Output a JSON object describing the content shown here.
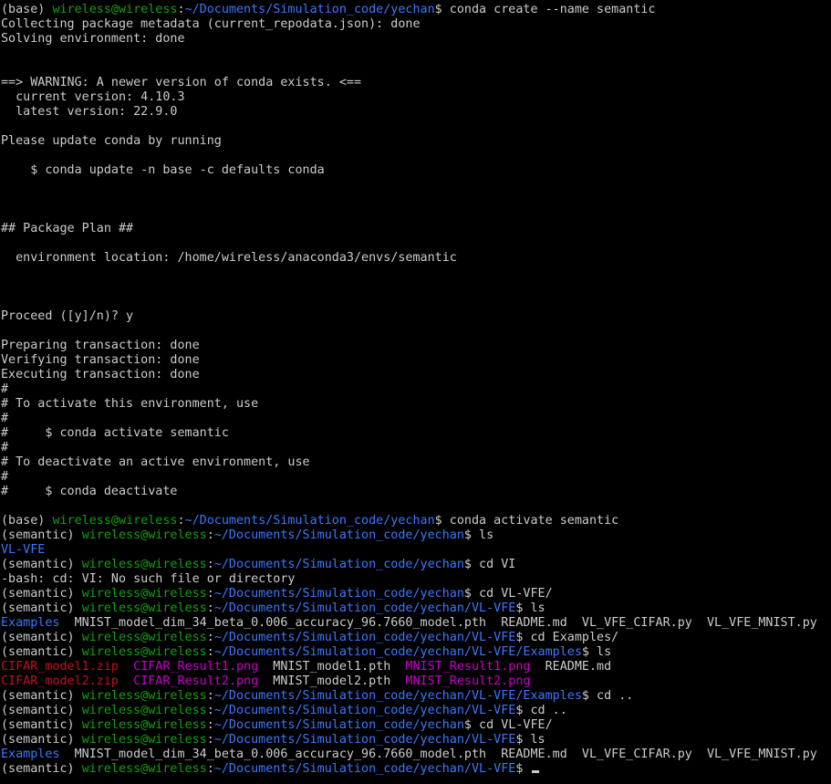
{
  "lines": [
    [
      [
        "p",
        "(base) "
      ],
      [
        "u",
        "wireless@wireless"
      ],
      [
        "p",
        ":"
      ],
      [
        "d",
        "~/Documents/Simulation_code/yechan"
      ],
      [
        "p",
        "$ conda create --name semantic"
      ]
    ],
    [
      [
        "p",
        "Collecting package metadata (current_repodata.json): done"
      ]
    ],
    [
      [
        "p",
        "Solving environment: done"
      ]
    ],
    [],
    [],
    [
      [
        "p",
        "==> WARNING: A newer version of conda exists. <=="
      ]
    ],
    [
      [
        "p",
        "  current version: 4.10.3"
      ]
    ],
    [
      [
        "p",
        "  latest version: 22.9.0"
      ]
    ],
    [],
    [
      [
        "p",
        "Please update conda by running"
      ]
    ],
    [],
    [
      [
        "p",
        "    $ conda update -n base -c defaults conda"
      ]
    ],
    [],
    [],
    [],
    [
      [
        "p",
        "## Package Plan ##"
      ]
    ],
    [],
    [
      [
        "p",
        "  environment location: /home/wireless/anaconda3/envs/semantic"
      ]
    ],
    [],
    [],
    [],
    [
      [
        "p",
        "Proceed ([y]/n)? y"
      ]
    ],
    [],
    [
      [
        "p",
        "Preparing transaction: done"
      ]
    ],
    [
      [
        "p",
        "Verifying transaction: done"
      ]
    ],
    [
      [
        "p",
        "Executing transaction: done"
      ]
    ],
    [
      [
        "p",
        "#"
      ]
    ],
    [
      [
        "p",
        "# To activate this environment, use"
      ]
    ],
    [
      [
        "p",
        "#"
      ]
    ],
    [
      [
        "p",
        "#     $ conda activate semantic"
      ]
    ],
    [
      [
        "p",
        "#"
      ]
    ],
    [
      [
        "p",
        "# To deactivate an active environment, use"
      ]
    ],
    [
      [
        "p",
        "#"
      ]
    ],
    [
      [
        "p",
        "#     $ conda deactivate"
      ]
    ],
    [],
    [
      [
        "p",
        "(base) "
      ],
      [
        "u",
        "wireless@wireless"
      ],
      [
        "p",
        ":"
      ],
      [
        "d",
        "~/Documents/Simulation_code/yechan"
      ],
      [
        "p",
        "$ conda activate semantic"
      ]
    ],
    [
      [
        "p",
        "(semantic) "
      ],
      [
        "u",
        "wireless@wireless"
      ],
      [
        "p",
        ":"
      ],
      [
        "d",
        "~/Documents/Simulation_code/yechan"
      ],
      [
        "p",
        "$ ls"
      ]
    ],
    [
      [
        "f",
        "VL-VFE"
      ]
    ],
    [
      [
        "p",
        "(semantic) "
      ],
      [
        "u",
        "wireless@wireless"
      ],
      [
        "p",
        ":"
      ],
      [
        "d",
        "~/Documents/Simulation_code/yechan"
      ],
      [
        "p",
        "$ cd VI"
      ]
    ],
    [
      [
        "p",
        "-bash: cd: VI: No such file or directory"
      ]
    ],
    [
      [
        "p",
        "(semantic) "
      ],
      [
        "u",
        "wireless@wireless"
      ],
      [
        "p",
        ":"
      ],
      [
        "d",
        "~/Documents/Simulation_code/yechan"
      ],
      [
        "p",
        "$ cd VL-VFE/"
      ]
    ],
    [
      [
        "p",
        "(semantic) "
      ],
      [
        "u",
        "wireless@wireless"
      ],
      [
        "p",
        ":"
      ],
      [
        "d",
        "~/Documents/Simulation_code/yechan/VL-VFE"
      ],
      [
        "p",
        "$ ls"
      ]
    ],
    [
      [
        "f",
        "Examples"
      ],
      [
        "p",
        "  MNIST_model_dim_34_beta_0.006_accuracy_96.7660_model.pth  README.md  VL_VFE_CIFAR.py  VL_VFE_MNIST.py"
      ]
    ],
    [
      [
        "p",
        "(semantic) "
      ],
      [
        "u",
        "wireless@wireless"
      ],
      [
        "p",
        ":"
      ],
      [
        "d",
        "~/Documents/Simulation_code/yechan/VL-VFE"
      ],
      [
        "p",
        "$ cd Examples/"
      ]
    ],
    [
      [
        "p",
        "(semantic) "
      ],
      [
        "u",
        "wireless@wireless"
      ],
      [
        "p",
        ":"
      ],
      [
        "d",
        "~/Documents/Simulation_code/yechan/VL-VFE/Examples"
      ],
      [
        "p",
        "$ ls"
      ]
    ],
    [
      [
        "z",
        "CIFAR_model1.zip"
      ],
      [
        "p",
        "  "
      ],
      [
        "i",
        "CIFAR_Result1.png"
      ],
      [
        "p",
        "  MNIST_model1.pth  "
      ],
      [
        "i",
        "MNIST_Result1.png"
      ],
      [
        "p",
        "  README.md"
      ]
    ],
    [
      [
        "z",
        "CIFAR_model2.zip"
      ],
      [
        "p",
        "  "
      ],
      [
        "i",
        "CIFAR_Result2.png"
      ],
      [
        "p",
        "  MNIST_model2.pth  "
      ],
      [
        "i",
        "MNIST_Result2.png"
      ]
    ],
    [
      [
        "p",
        "(semantic) "
      ],
      [
        "u",
        "wireless@wireless"
      ],
      [
        "p",
        ":"
      ],
      [
        "d",
        "~/Documents/Simulation_code/yechan/VL-VFE/Examples"
      ],
      [
        "p",
        "$ cd .."
      ]
    ],
    [
      [
        "p",
        "(semantic) "
      ],
      [
        "u",
        "wireless@wireless"
      ],
      [
        "p",
        ":"
      ],
      [
        "d",
        "~/Documents/Simulation_code/yechan/VL-VFE"
      ],
      [
        "p",
        "$ cd .."
      ]
    ],
    [
      [
        "p",
        "(semantic) "
      ],
      [
        "u",
        "wireless@wireless"
      ],
      [
        "p",
        ":"
      ],
      [
        "d",
        "~/Documents/Simulation_code/yechan"
      ],
      [
        "p",
        "$ cd VL-VFE/"
      ]
    ],
    [
      [
        "p",
        "(semantic) "
      ],
      [
        "u",
        "wireless@wireless"
      ],
      [
        "p",
        ":"
      ],
      [
        "d",
        "~/Documents/Simulation_code/yechan/VL-VFE"
      ],
      [
        "p",
        "$ ls"
      ]
    ],
    [
      [
        "f",
        "Examples"
      ],
      [
        "p",
        "  MNIST_model_dim_34_beta_0.006_accuracy_96.7660_model.pth  README.md  VL_VFE_CIFAR.py  VL_VFE_MNIST.py"
      ]
    ],
    [
      [
        "p",
        "(semantic) "
      ],
      [
        "u",
        "wireless@wireless"
      ],
      [
        "p",
        ":"
      ],
      [
        "d",
        "~/Documents/Simulation_code/yechan/VL-VFE"
      ],
      [
        "p",
        "$ "
      ],
      [
        "c",
        ""
      ]
    ]
  ],
  "colors": {
    "background": "#000000",
    "foreground": "#cccccc",
    "userhost": "#13a10e",
    "path": "#3b78ff",
    "directory": "#3b78ff",
    "archive": "#c50f1f",
    "image": "#c800c8"
  }
}
